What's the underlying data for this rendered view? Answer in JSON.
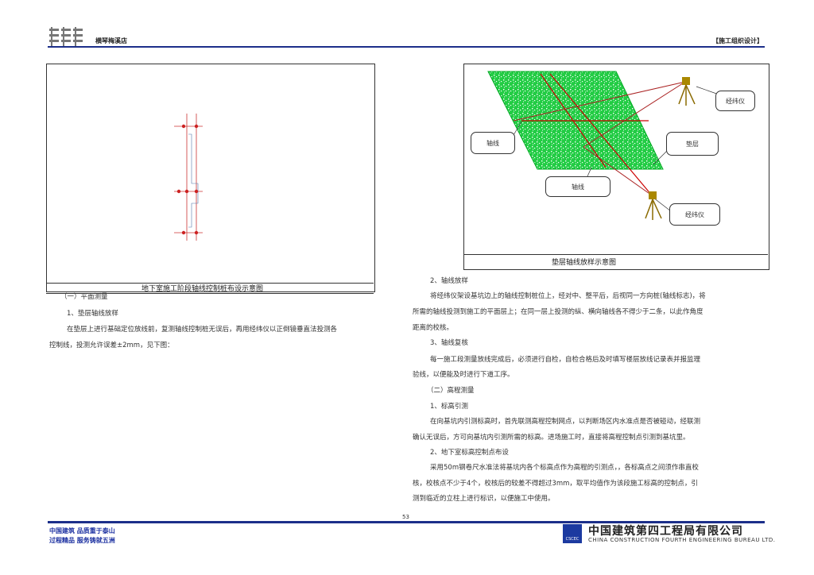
{
  "header": {
    "company_short": "横琴梅溪店",
    "doc_type": "【施工组织设计】"
  },
  "left_figure": {
    "caption": "地下室施工阶段轴线控制桩布设示意图"
  },
  "left_text": {
    "section_title": "（一）平面测量",
    "item1_title": "1、垫层轴线放样",
    "item1_line1": "在垫层上进行基础定位放线前，复测轴线控制桩无误后，再用经纬仪以正倒镜垂直法投测各",
    "item1_line2": "控制线，投测允许误差±2mm，见下图："
  },
  "right_figure": {
    "caption": "垫层轴线放样示意图",
    "labels": {
      "theodolite_top": "经纬仪",
      "theodolite_bottom": "经纬仪",
      "axis_left": "轴线",
      "axis_bottom": "轴线",
      "cushion": "垫层"
    },
    "colors": {
      "slab": "#00cc33",
      "axis_line": "#cc0000",
      "instrument": "#9a7a00"
    }
  },
  "right_text": {
    "item2_title": "2、轴线放样",
    "item2_line1": "将经纬仪架设基坑边上的轴线控制桩位上，经对中、整平后，后视同一方向桩(轴线标志)，将",
    "item2_line2": "所需的轴线投测到施工的平面层上；在同一层上投测的纵、横向轴线各不得少于二条，以此作角度",
    "item2_line3": "距离的校核。",
    "item3_title": "3、轴线复核",
    "item3_line1": "每一施工段测量放线完成后，必须进行自检，自检合格后及时填写楼层放线记录表并报监理",
    "item3_line2": "验线，以便能及时进行下道工序。",
    "section2_title": "（二）高程测量",
    "h1_title": "1、标高引测",
    "h1_line1": "在向基坑内引测标高时，首先联测高程控制网点，以判断场区内水准点是否被碰动，经联测",
    "h1_line2": "确认无误后，方可向基坑内引测所需的标高。进场施工时，直接将高程控制点引测到基坑里。",
    "h2_title": "2、地下室标高控制点布设",
    "h2_line1": "采用50m钢卷尺水准法将基坑内各个标高点作为高程的引测点，，各标高点之间须作串直校",
    "h2_line2": "核，校核点不少于4个，校核后的较差不得超过3mm，取平均值作为该段施工标高的控制点，引",
    "h2_line3": "测到临近的立柱上进行标识，以便施工中使用。"
  },
  "page_number": "53",
  "footer": {
    "slogan1": "中国建筑  品质重于泰山",
    "slogan2": "过程精品  服务铸就五洲",
    "company_cn": "中国建筑第四工程局有限公司",
    "company_en": "CHINA CONSTRUCTION FOURTH ENGINEERING BUREAU LTD.",
    "logo_text": "CSCEC"
  }
}
